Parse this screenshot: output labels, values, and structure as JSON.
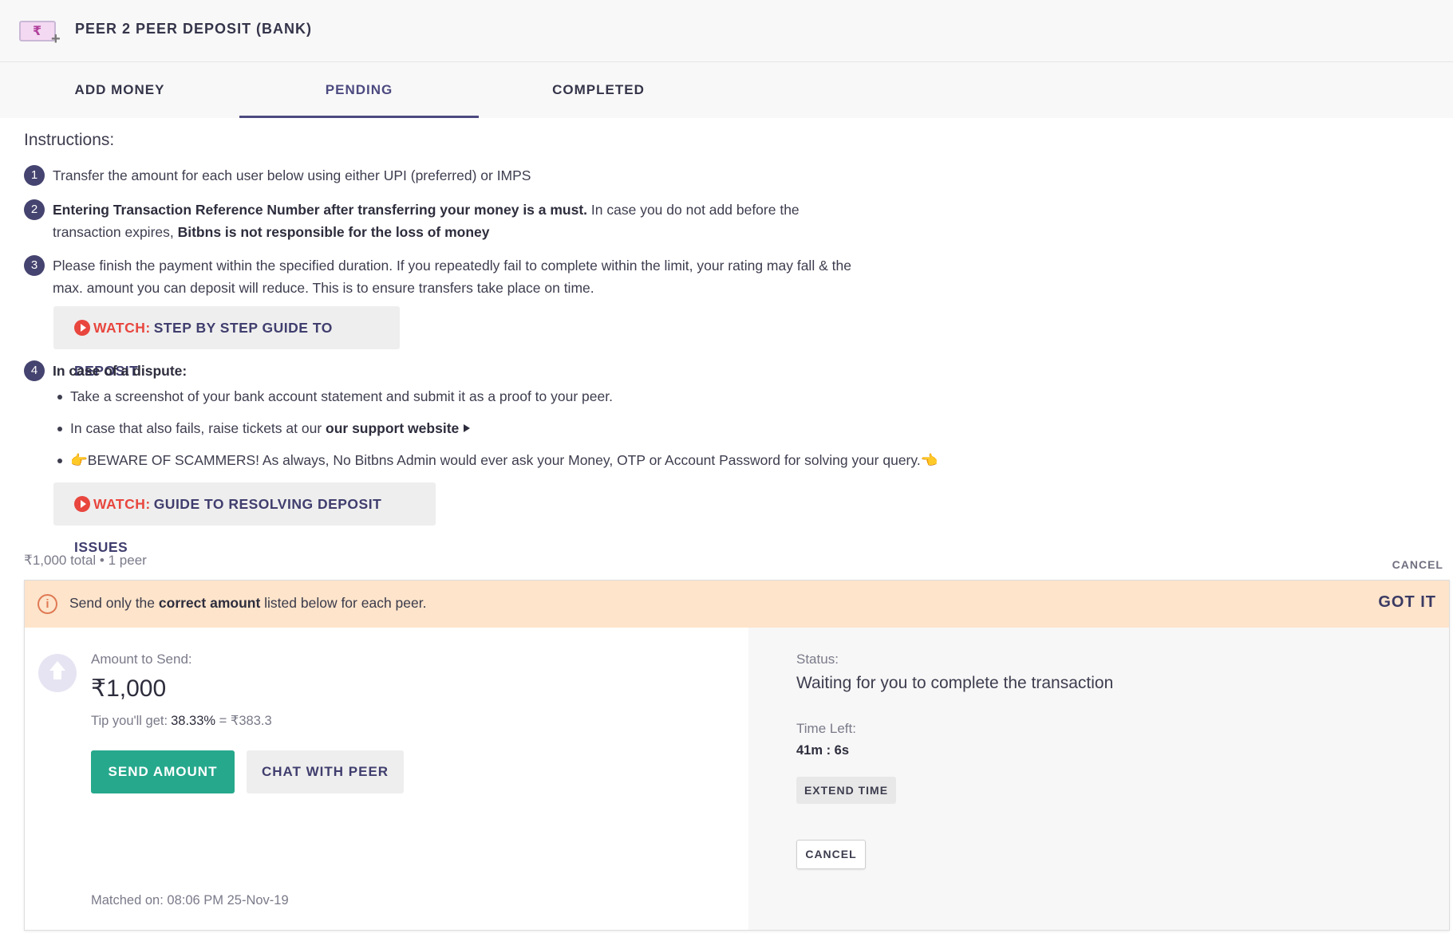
{
  "header": {
    "title": "PEER 2 PEER DEPOSIT (BANK)",
    "logo_symbol": "₹",
    "logo_plus": "+"
  },
  "tabs": [
    {
      "label": "ADD MONEY",
      "active": false
    },
    {
      "label": "PENDING",
      "active": true
    },
    {
      "label": "COMPLETED",
      "active": false
    }
  ],
  "instructions": {
    "title": "Instructions:",
    "steps": [
      {
        "num": "1",
        "text": "Transfer the amount for each user below using either UPI (preferred) or IMPS"
      },
      {
        "num": "2",
        "bold1": "Entering Transaction Reference Number after transferring your money is a must.",
        "text1": " In case you do not add before the transaction expires, ",
        "bold2": "Bitbns is not responsible for the loss of money"
      },
      {
        "num": "3",
        "text": "Please finish the payment within the specified duration. If you repeatedly fail to complete within the limit, your rating may fall & the max. amount you can deposit will reduce. This is to ensure transfers take place on time."
      },
      {
        "num": "4",
        "bold": "In case of a dispute:"
      }
    ],
    "watch_label": "WATCH:",
    "watch_guide": "STEP BY STEP GUIDE TO DEPOSIT",
    "bullets": [
      {
        "text": "Take a screenshot of your bank account statement and submit it as a proof to your peer."
      },
      {
        "text": "In case that also fails, raise tickets at our ",
        "bold": "our support website"
      },
      {
        "text": "👉BEWARE OF SCAMMERS! As always, No Bitbns Admin would ever ask your Money, OTP or Account Password for solving your query.👈"
      }
    ],
    "watch_issues": "GUIDE TO RESOLVING DEPOSIT ISSUES"
  },
  "summary": {
    "text": "₹1,000 total  •  1 peer",
    "cancel_label": "CANCEL"
  },
  "alert": {
    "icon": "info-icon",
    "pre": "Send only the ",
    "bold": "correct amount",
    "post": " listed below for each peer.",
    "gotit": "GOT IT"
  },
  "transaction": {
    "amount_label": "Amount to Send:",
    "amount": "₹1,000",
    "tip_label": "Tip you'll get:",
    "tip_percent": "38.33%",
    "tip_value": "= ₹383.3",
    "send_button": "SEND AMOUNT",
    "chat_button": "CHAT WITH PEER",
    "matched": "Matched on: 08:06 PM 25-Nov-19",
    "status_label": "Status:",
    "status_text": "Waiting for you to complete the transaction",
    "time_label": "Time Left:",
    "time_value": "41m : 6s",
    "extend_button": "EXTEND TIME",
    "cancel_button": "CANCEL"
  },
  "colors": {
    "accent": "#4c4a80",
    "send_button": "#26a88c",
    "watch_red": "#e8463e",
    "alert_bg": "#fde4cb"
  }
}
